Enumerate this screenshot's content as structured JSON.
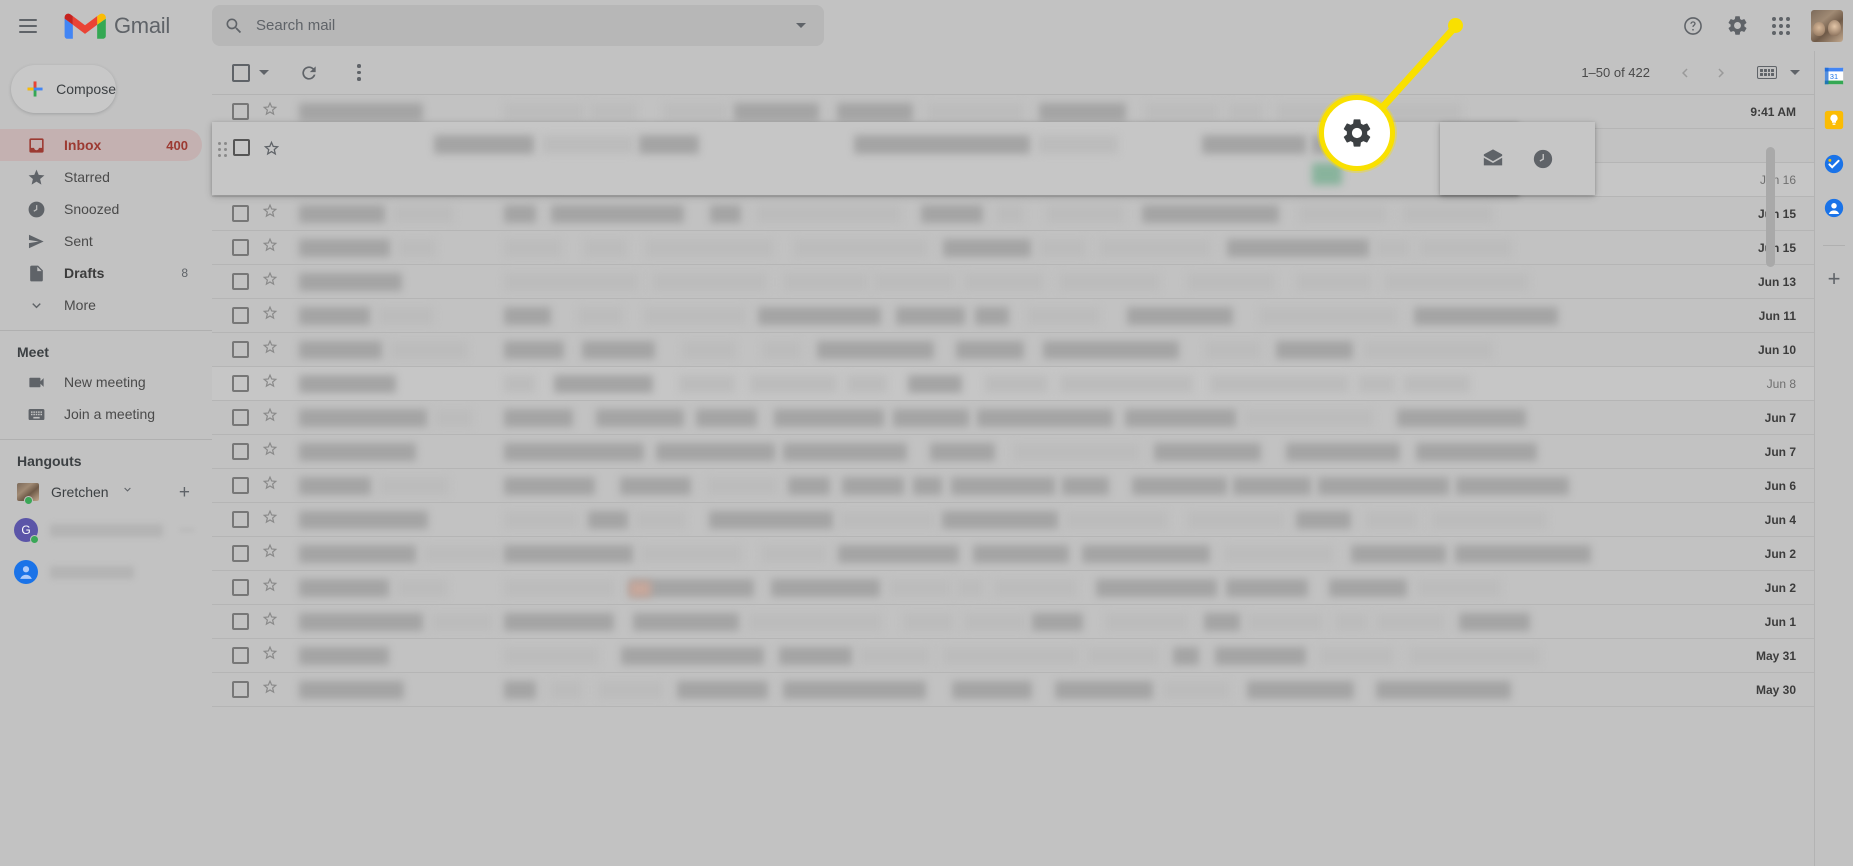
{
  "app": {
    "name": "Gmail",
    "logo_icon": "gmail-m-logo"
  },
  "topbar": {
    "menu_icon": "hamburger-menu-icon",
    "search": {
      "placeholder": "Search mail",
      "value": "",
      "search_icon": "search-icon",
      "options_icon": "show-search-options-icon"
    },
    "help_icon": "help-question-icon",
    "settings_icon": "settings-gear-icon",
    "apps_icon": "google-apps-grid-icon",
    "account_avatar_icon": "account-avatar"
  },
  "sidebar": {
    "compose": {
      "label": "Compose",
      "icon": "compose-plus-icon"
    },
    "nav": [
      {
        "label": "Inbox",
        "icon": "inbox-icon",
        "count": "400",
        "active": true,
        "bold": true
      },
      {
        "label": "Starred",
        "icon": "star-icon",
        "count": "",
        "active": false,
        "bold": false
      },
      {
        "label": "Snoozed",
        "icon": "clock-icon",
        "count": "",
        "active": false,
        "bold": false
      },
      {
        "label": "Sent",
        "icon": "send-icon",
        "count": "",
        "active": false,
        "bold": false
      },
      {
        "label": "Drafts",
        "icon": "draft-icon",
        "count": "8",
        "active": false,
        "bold": true
      },
      {
        "label": "More",
        "icon": "chevron-down-icon",
        "count": "",
        "active": false,
        "bold": false
      }
    ],
    "meet": {
      "title": "Meet",
      "items": [
        {
          "label": "New meeting",
          "icon": "video-camera-icon"
        },
        {
          "label": "Join a meeting",
          "icon": "keyboard-icon"
        }
      ]
    },
    "hangouts": {
      "title": "Hangouts",
      "user": {
        "name": "Gretchen",
        "status": "online",
        "caret_icon": "chevron-down-icon",
        "avatar_icon": "hangouts-user-avatar"
      },
      "add_icon": "add-conversation-plus-icon",
      "contacts": [
        {
          "avatar_letter": "G",
          "avatar_color": "#5b55a8",
          "status": "online",
          "name_blurred": true
        },
        {
          "avatar_letter": "",
          "avatar_color": "#1a73e8",
          "status": "none",
          "name_blurred": true
        }
      ]
    }
  },
  "toolbar": {
    "select_all_icon": "select-all-checkbox",
    "select_all_caret_icon": "chevron-down-icon",
    "refresh_icon": "refresh-icon",
    "more_icon": "more-options-vertical-dots-icon",
    "pagination": "1–50 of 422",
    "prev_icon": "chevron-left-icon",
    "next_icon": "chevron-right-icon",
    "input_tools_icon": "keyboard-input-tools-icon",
    "input_tools_caret_icon": "chevron-down-icon"
  },
  "hover_row": {
    "mark_read_icon": "mark-as-read-envelope-icon",
    "snooze_icon": "snooze-clock-icon"
  },
  "email_list": {
    "checkbox_icon": "row-checkbox",
    "star_icon": "star-outline-icon",
    "rows": [
      {
        "date": "9:41 AM",
        "read": false
      },
      {
        "date": "",
        "read": false
      },
      {
        "date": "Jun 16",
        "read": true
      },
      {
        "date": "Jun 15",
        "read": false
      },
      {
        "date": "Jun 15",
        "read": false
      },
      {
        "date": "Jun 13",
        "read": false
      },
      {
        "date": "Jun 11",
        "read": false
      },
      {
        "date": "Jun 10",
        "read": false
      },
      {
        "date": "Jun 8",
        "read": true
      },
      {
        "date": "Jun 7",
        "read": false
      },
      {
        "date": "Jun 7",
        "read": false
      },
      {
        "date": "Jun 6",
        "read": false
      },
      {
        "date": "Jun 4",
        "read": false
      },
      {
        "date": "Jun 2",
        "read": false
      },
      {
        "date": "Jun 2",
        "read": false
      },
      {
        "date": "Jun 1",
        "read": false
      },
      {
        "date": "May 31",
        "read": false
      },
      {
        "date": "May 30",
        "read": false
      }
    ]
  },
  "right_rail": {
    "items": [
      {
        "icon": "google-calendar-icon",
        "label": "31"
      },
      {
        "icon": "google-keep-icon",
        "label": ""
      },
      {
        "icon": "google-tasks-icon",
        "label": ""
      },
      {
        "icon": "google-contacts-icon",
        "label": ""
      }
    ],
    "add_icon": "get-add-ons-plus-icon"
  },
  "callout": {
    "target_icon": "settings-gear-icon",
    "ring_color": "#f9e000",
    "fill_color": "#ffffff"
  }
}
